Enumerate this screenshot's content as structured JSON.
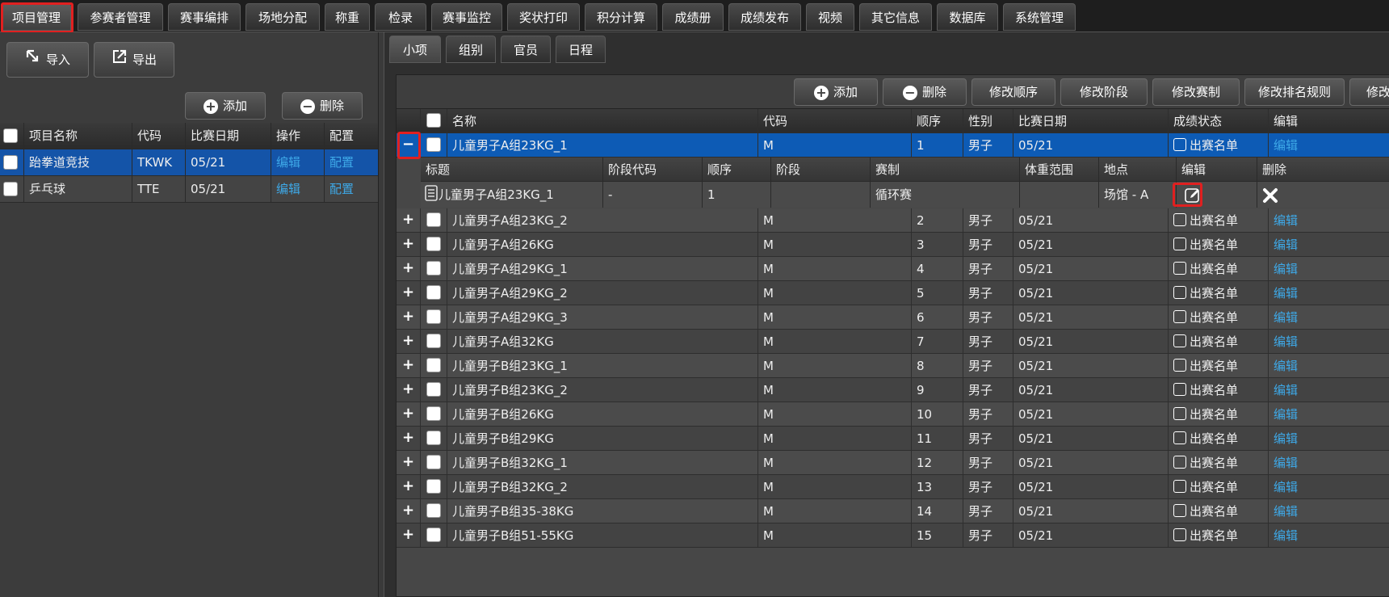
{
  "top_menu": [
    "项目管理",
    "参赛者管理",
    "赛事编排",
    "场地分配",
    "称重",
    "检录",
    "赛事监控",
    "奖状打印",
    "积分计算",
    "成绩册",
    "成绩发布",
    "视频",
    "其它信息",
    "数据库",
    "系统管理"
  ],
  "left": {
    "import_label": "导入",
    "export_label": "导出",
    "add_label": "添加",
    "delete_label": "删除",
    "columns": [
      "项目名称",
      "代码",
      "比赛日期",
      "操作",
      "配置"
    ],
    "rows": [
      {
        "name": "跆拳道竞技",
        "code": "TKWK",
        "date": "05/21",
        "op": "编辑",
        "cfg": "配置",
        "selected": true
      },
      {
        "name": "乒乓球",
        "code": "TTE",
        "date": "05/21",
        "op": "编辑",
        "cfg": "配置",
        "selected": false
      }
    ]
  },
  "sub_tabs": [
    "小项",
    "组别",
    "官员",
    "日程"
  ],
  "toolbar": [
    "添加",
    "删除",
    "修改顺序",
    "修改阶段",
    "修改赛制",
    "修改排名规则",
    "修改"
  ],
  "grid": {
    "columns": [
      "名称",
      "代码",
      "顺序",
      "性别",
      "比赛日期",
      "成绩状态",
      "编辑"
    ],
    "rows": [
      {
        "name": "儿童男子A组23KG_1",
        "code": "M",
        "order": "1",
        "gender": "男子",
        "date": "05/21",
        "status": "出赛名单",
        "edit": "编辑"
      },
      {
        "name": "儿童男子A组23KG_2",
        "code": "M",
        "order": "2",
        "gender": "男子",
        "date": "05/21",
        "status": "出赛名单",
        "edit": "编辑"
      },
      {
        "name": "儿童男子A组26KG",
        "code": "M",
        "order": "3",
        "gender": "男子",
        "date": "05/21",
        "status": "出赛名单",
        "edit": "编辑"
      },
      {
        "name": "儿童男子A组29KG_1",
        "code": "M",
        "order": "4",
        "gender": "男子",
        "date": "05/21",
        "status": "出赛名单",
        "edit": "编辑"
      },
      {
        "name": "儿童男子A组29KG_2",
        "code": "M",
        "order": "5",
        "gender": "男子",
        "date": "05/21",
        "status": "出赛名单",
        "edit": "编辑"
      },
      {
        "name": "儿童男子A组29KG_3",
        "code": "M",
        "order": "6",
        "gender": "男子",
        "date": "05/21",
        "status": "出赛名单",
        "edit": "编辑"
      },
      {
        "name": "儿童男子A组32KG",
        "code": "M",
        "order": "7",
        "gender": "男子",
        "date": "05/21",
        "status": "出赛名单",
        "edit": "编辑"
      },
      {
        "name": "儿童男子B组23KG_1",
        "code": "M",
        "order": "8",
        "gender": "男子",
        "date": "05/21",
        "status": "出赛名单",
        "edit": "编辑"
      },
      {
        "name": "儿童男子B组23KG_2",
        "code": "M",
        "order": "9",
        "gender": "男子",
        "date": "05/21",
        "status": "出赛名单",
        "edit": "编辑"
      },
      {
        "name": "儿童男子B组26KG",
        "code": "M",
        "order": "10",
        "gender": "男子",
        "date": "05/21",
        "status": "出赛名单",
        "edit": "编辑"
      },
      {
        "name": "儿童男子B组29KG",
        "code": "M",
        "order": "11",
        "gender": "男子",
        "date": "05/21",
        "status": "出赛名单",
        "edit": "编辑"
      },
      {
        "name": "儿童男子B组32KG_1",
        "code": "M",
        "order": "12",
        "gender": "男子",
        "date": "05/21",
        "status": "出赛名单",
        "edit": "编辑"
      },
      {
        "name": "儿童男子B组32KG_2",
        "code": "M",
        "order": "13",
        "gender": "男子",
        "date": "05/21",
        "status": "出赛名单",
        "edit": "编辑"
      },
      {
        "name": "儿童男子B组35-38KG",
        "code": "M",
        "order": "14",
        "gender": "男子",
        "date": "05/21",
        "status": "出赛名单",
        "edit": "编辑"
      },
      {
        "name": "儿童男子B组51-55KG",
        "code": "M",
        "order": "15",
        "gender": "男子",
        "date": "05/21",
        "status": "出赛名单",
        "edit": "编辑"
      }
    ]
  },
  "detail": {
    "columns": [
      "标题",
      "阶段代码",
      "顺序",
      "阶段",
      "赛制",
      "体重范围",
      "地点",
      "编辑",
      "删除"
    ],
    "row": {
      "title": "儿童男子A组23KG_1",
      "stage_code": "-",
      "order": "1",
      "stage": "",
      "format": "循环赛",
      "weight": "",
      "venue": "场馆 - A"
    }
  }
}
